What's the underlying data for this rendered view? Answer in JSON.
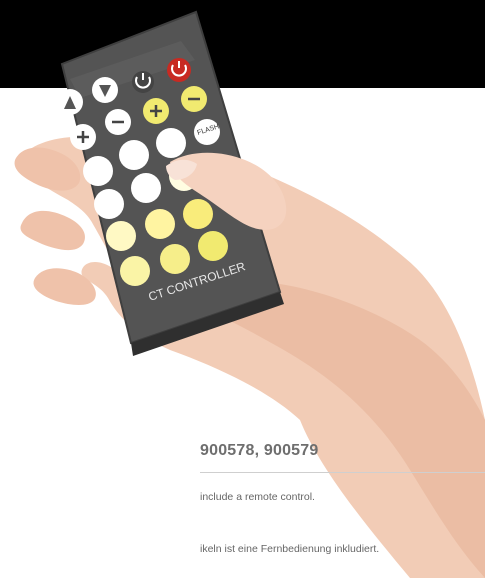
{
  "colors": {
    "band": "#000000",
    "remote_body": "#5a5a5a",
    "power_button": "#c82a22",
    "yellow_button": "#f1ea70",
    "white_button": "#ffffff"
  },
  "remote": {
    "brand_label": "CT CONTROLLER",
    "flash_label": "FLASH",
    "icons": [
      "power-icon",
      "power-red-icon",
      "bulb-up-icon",
      "bulb-down-icon",
      "plus-icon",
      "minus-icon"
    ]
  },
  "product_numbers": "900578, 900579",
  "caption_en": "include a remote control.",
  "caption_de": "ikeln ist eine Fernbedienung inkludiert."
}
